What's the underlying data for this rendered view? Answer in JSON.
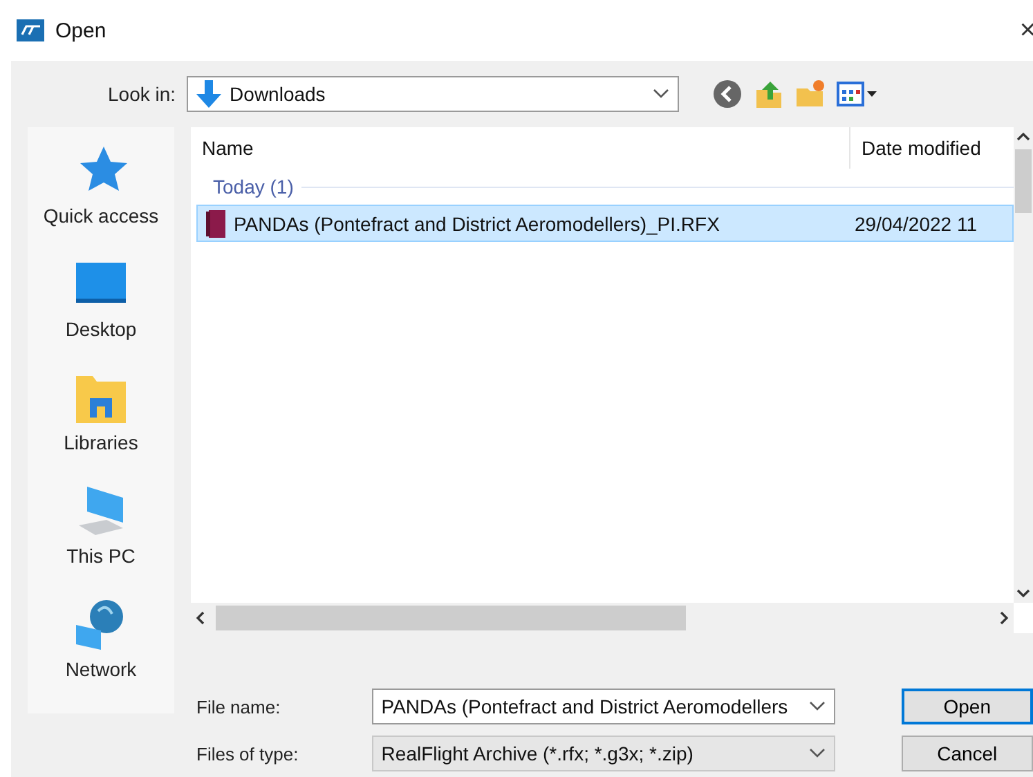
{
  "window": {
    "title": "Open",
    "close": "×"
  },
  "look_in": {
    "label": "Look in:",
    "value": "Downloads"
  },
  "places": [
    {
      "label": "Quick access",
      "kind": "star"
    },
    {
      "label": "Desktop",
      "kind": "desktop"
    },
    {
      "label": "Libraries",
      "kind": "libraries"
    },
    {
      "label": "This PC",
      "kind": "pc"
    },
    {
      "label": "Network",
      "kind": "network"
    }
  ],
  "file_list": {
    "columns": [
      "Name",
      "Date modified"
    ],
    "groups": [
      {
        "label": "Today (1)",
        "rows": [
          {
            "name": "PANDAs (Pontefract and District Aeromodellers)_PI.RFX",
            "date": "29/04/2022 11",
            "selected": true
          }
        ]
      }
    ]
  },
  "file_name": {
    "label": "File name:",
    "value": "PANDAs (Pontefract and District Aeromodellers"
  },
  "file_type": {
    "label": "Files of type:",
    "value": "RealFlight Archive (*.rfx; *.g3x; *.zip)"
  },
  "buttons": [
    {
      "label": "Open",
      "default": true
    },
    {
      "label": "Cancel",
      "default": false
    }
  ]
}
